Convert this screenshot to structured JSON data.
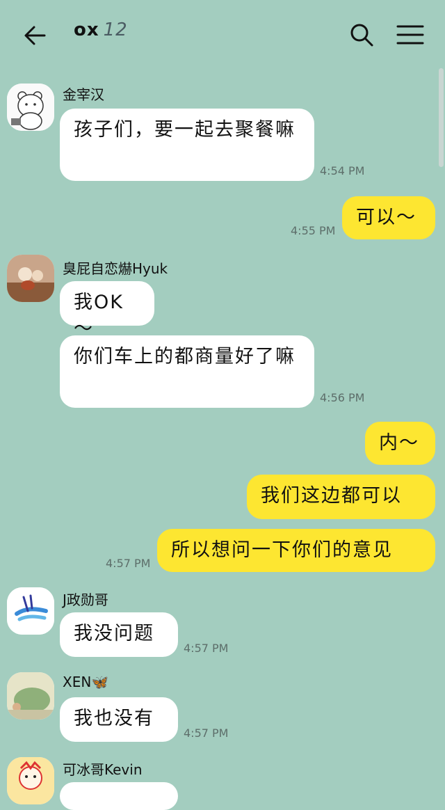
{
  "header": {
    "title": "ox",
    "member_count": "12"
  },
  "messages": [
    {
      "sender": "金宰汉",
      "text": "孩子们，要一起去聚餐嘛",
      "time": "4:54 PM"
    },
    {
      "text": "可以～",
      "time": "4:55 PM"
    },
    {
      "sender": "臭屁自恋爀Hyuk",
      "text": "我OK～"
    },
    {
      "text": "你们车上的都商量好了嘛",
      "time": "4:56 PM"
    },
    {
      "text": "内～"
    },
    {
      "text": "我们这边都可以"
    },
    {
      "text": "所以想问一下你们的意见",
      "time": "4:57 PM"
    },
    {
      "sender": "J政勋哥",
      "text": "我没问题",
      "time": "4:57 PM"
    },
    {
      "sender": "XEN🦋",
      "text": "我也没有",
      "time": "4:57 PM"
    },
    {
      "sender": "可冰哥Kevin"
    }
  ],
  "colors": {
    "background": "#a3cdbf",
    "outgoing": "#fde631",
    "incoming": "#ffffff"
  }
}
